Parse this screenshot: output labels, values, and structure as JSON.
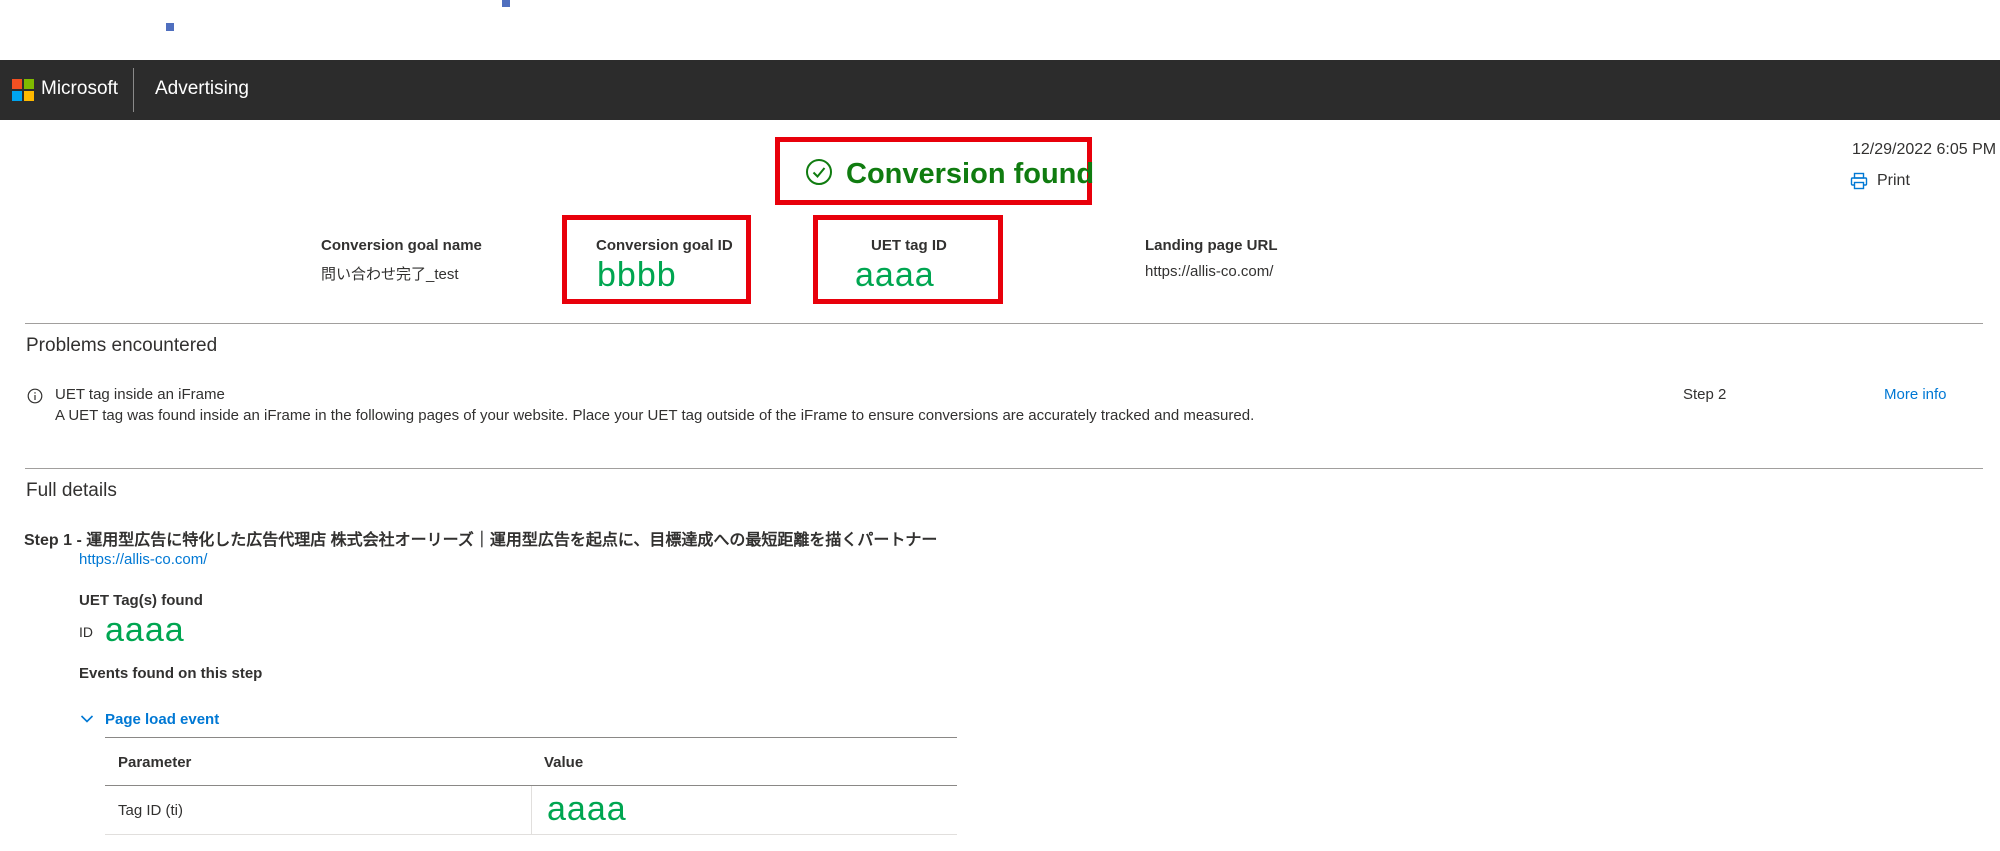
{
  "header": {
    "brand": "Microsoft",
    "product": "Advertising"
  },
  "status": {
    "title": "Conversion found",
    "icon": "check-circle-icon",
    "color": "#107c10"
  },
  "timestamp": "12/29/2022 6:05 PM",
  "print_label": "Print",
  "summary": {
    "goal_name_label": "Conversion goal name",
    "goal_name_value": "問い合わせ完了_test",
    "goal_id_label": "Conversion goal ID",
    "goal_id_value": "bbbb",
    "tag_id_label": "UET tag ID",
    "tag_id_value": "aaaa",
    "landing_label": "Landing page URL",
    "landing_value": "https://allis-co.com/"
  },
  "problems": {
    "title": "Problems encountered",
    "items": [
      {
        "title": "UET tag inside an iFrame",
        "description": "A UET tag was found inside an iFrame in the following pages of your website. Place your UET tag outside of the iFrame to ensure conversions are accurately tracked and measured.",
        "step": "Step 2",
        "link": "More info"
      }
    ]
  },
  "details": {
    "title": "Full details",
    "steps": [
      {
        "title": "Step 1 - 運用型広告に特化した広告代理店 株式会社オーリーズ｜運用型広告を起点に、目標達成への最短距離を描くパートナー",
        "url": "https://allis-co.com/",
        "tags_found_label": "UET Tag(s) found",
        "id_label": "ID",
        "id_value": "aaaa",
        "events_label": "Events found on this step",
        "event_name": "Page load event",
        "table": {
          "columns": [
            "Parameter",
            "Value"
          ],
          "rows": [
            [
              "Tag ID (ti)",
              "aaaa"
            ]
          ]
        }
      }
    ]
  },
  "colors": {
    "topbar": "#2c2c2c",
    "highlight_box": "#e8000b",
    "annotation_green": "#00a651",
    "link": "#0078d4"
  }
}
